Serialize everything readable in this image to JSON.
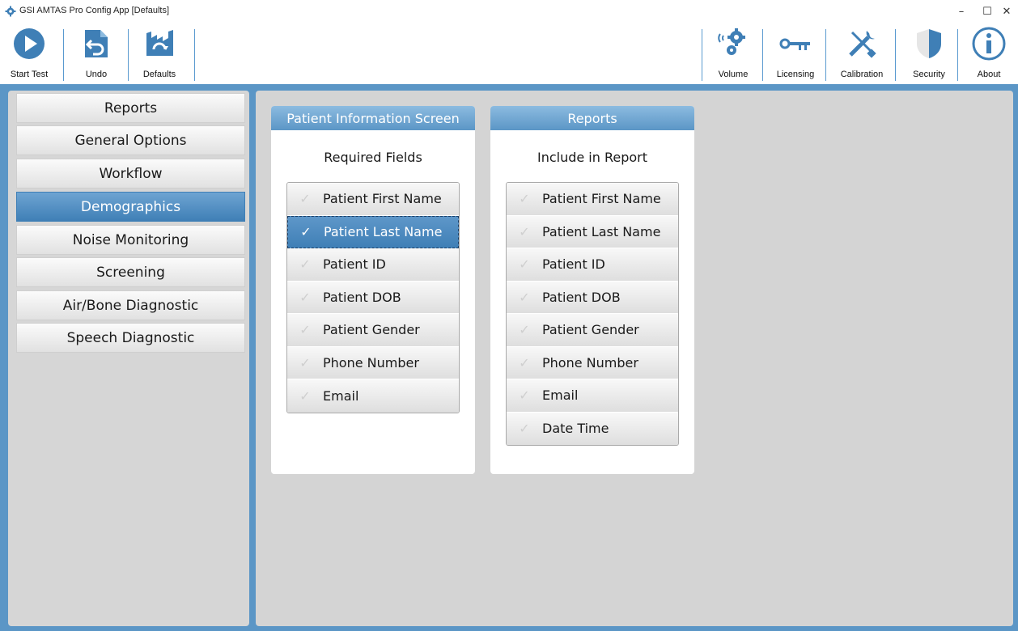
{
  "window": {
    "title": "GSI AMTAS Pro Config App [Defaults]",
    "minimize": "–",
    "maximize": "☐",
    "close": "✕"
  },
  "toolbar": {
    "left": [
      {
        "label": "Start Test",
        "icon": "play-icon"
      },
      {
        "label": "Undo",
        "icon": "undo-icon"
      },
      {
        "label": "Defaults",
        "icon": "factory-reset-icon"
      }
    ],
    "right": [
      {
        "label": "Volume",
        "icon": "volume-gear-icon"
      },
      {
        "label": "Licensing",
        "icon": "key-icon"
      },
      {
        "label": "Calibration",
        "icon": "tools-icon"
      },
      {
        "label": "Security",
        "icon": "shield-icon"
      },
      {
        "label": "About",
        "icon": "info-icon"
      }
    ]
  },
  "sidebar": {
    "items": [
      {
        "label": "Reports",
        "active": false
      },
      {
        "label": "General Options",
        "active": false
      },
      {
        "label": "Workflow",
        "active": false
      },
      {
        "label": "Demographics",
        "active": true
      },
      {
        "label": "Noise Monitoring",
        "active": false
      },
      {
        "label": "Screening",
        "active": false
      },
      {
        "label": "Air/Bone Diagnostic",
        "active": false
      },
      {
        "label": "Speech Diagnostic",
        "active": false
      }
    ]
  },
  "panels": [
    {
      "title": "Patient Information Screen",
      "subtitle": "Required Fields",
      "items": [
        {
          "label": "Patient First Name",
          "checked": false
        },
        {
          "label": "Patient Last Name",
          "checked": true
        },
        {
          "label": "Patient ID",
          "checked": false
        },
        {
          "label": "Patient DOB",
          "checked": false
        },
        {
          "label": "Patient Gender",
          "checked": false
        },
        {
          "label": "Phone Number",
          "checked": false
        },
        {
          "label": "Email",
          "checked": false
        }
      ]
    },
    {
      "title": "Reports",
      "subtitle": "Include in Report",
      "items": [
        {
          "label": "Patient First Name",
          "checked": false
        },
        {
          "label": "Patient Last Name",
          "checked": false
        },
        {
          "label": "Patient ID",
          "checked": false
        },
        {
          "label": "Patient DOB",
          "checked": false
        },
        {
          "label": "Patient Gender",
          "checked": false
        },
        {
          "label": "Phone Number",
          "checked": false
        },
        {
          "label": "Email",
          "checked": false
        },
        {
          "label": "Date Time",
          "checked": false
        }
      ]
    }
  ],
  "colors": {
    "accent": "#3f7fb6",
    "frame": "#5b96c6",
    "panel_bg": "#d4d4d4"
  }
}
